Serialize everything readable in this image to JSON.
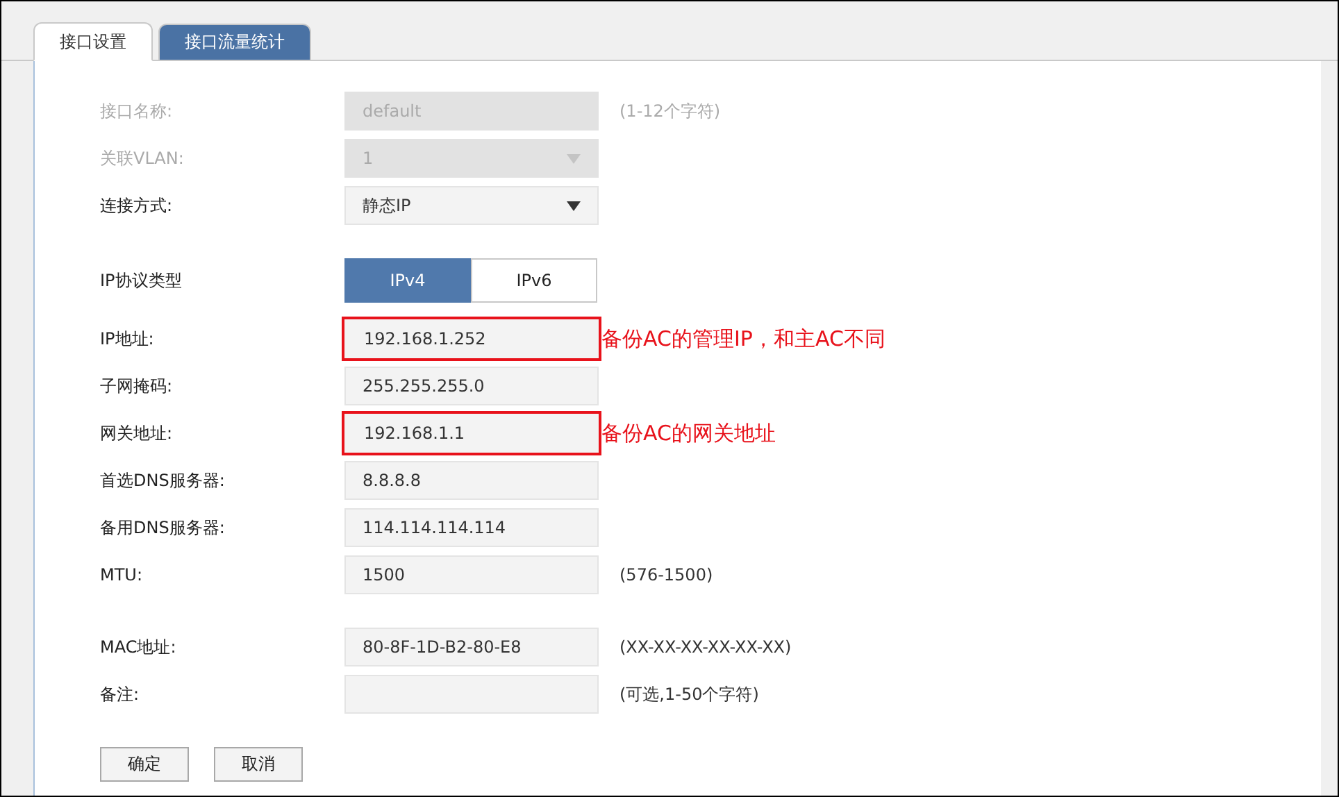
{
  "tabs": [
    {
      "label": "接口设置",
      "selected": true
    },
    {
      "label": "接口流量统计",
      "selected": false
    }
  ],
  "sections": [
    [
      {
        "kind": "text",
        "label": "接口名称:",
        "value": "default",
        "disabled": true,
        "highlighted": false,
        "hint": "(1-12个字符)"
      },
      {
        "kind": "select",
        "label": "关联VLAN:",
        "value": "1",
        "disabled": true,
        "highlighted": false
      },
      {
        "kind": "select",
        "label": "连接方式:",
        "value": "静态IP",
        "disabled": false,
        "highlighted": false
      }
    ],
    [
      {
        "kind": "toggle",
        "label": "IP协议类型",
        "disabled": false,
        "options": [
          {
            "label": "IPv4",
            "selected": true
          },
          {
            "label": "IPv6",
            "selected": false
          }
        ]
      },
      {
        "kind": "text",
        "label": "IP地址:",
        "value": "192.168.1.252",
        "disabled": false,
        "highlighted": true,
        "annotation": "备份AC的管理IP，和主AC不同"
      },
      {
        "kind": "text",
        "label": "子网掩码:",
        "value": "255.255.255.0",
        "disabled": false,
        "highlighted": false
      },
      {
        "kind": "text",
        "label": "网关地址:",
        "value": "192.168.1.1",
        "disabled": false,
        "highlighted": true,
        "annotation": "备份AC的网关地址"
      },
      {
        "kind": "text",
        "label": "首选DNS服务器:",
        "value": "8.8.8.8",
        "disabled": false,
        "highlighted": false
      },
      {
        "kind": "text",
        "label": "备用DNS服务器:",
        "value": "114.114.114.114",
        "disabled": false,
        "highlighted": false
      },
      {
        "kind": "text",
        "label": "MTU:",
        "value": "1500",
        "disabled": false,
        "highlighted": false,
        "hint": "(576-1500)"
      }
    ],
    [
      {
        "kind": "text",
        "label": "MAC地址:",
        "value": "80-8F-1D-B2-80-E8",
        "disabled": false,
        "highlighted": false,
        "hint": "(XX-XX-XX-XX-XX-XX)"
      },
      {
        "kind": "text",
        "label": "备注:",
        "disabled": false,
        "highlighted": false,
        "hint": "(可选,1-50个字符)"
      }
    ]
  ],
  "buttons": [
    "确定",
    "取消"
  ]
}
